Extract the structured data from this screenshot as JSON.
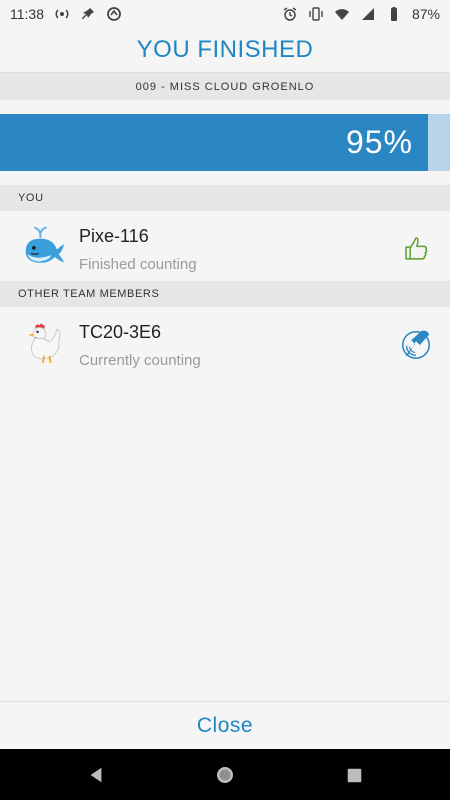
{
  "status_bar": {
    "time": "11:38",
    "battery": "87%",
    "left_icons": [
      "radio-icon",
      "pin-icon",
      "sync-icon"
    ],
    "right_icons": [
      "alarm-icon",
      "vibrate-icon",
      "wifi-icon",
      "signal-icon",
      "battery-icon"
    ]
  },
  "header": {
    "title": "YOU FINISHED"
  },
  "team": {
    "name": "009 - MISS CLOUD GROENLO"
  },
  "progress": {
    "percent_label": "95%",
    "value": 0.95,
    "fill_color": "#2b86c4",
    "track_color": "#b7d4ea"
  },
  "sections": {
    "you_label": "YOU",
    "others_label": "OTHER TEAM MEMBERS"
  },
  "you": {
    "name": "Pixe-116",
    "status": "Finished counting",
    "avatar_icon": "whale-icon",
    "action_icon": "thumbs-up-icon"
  },
  "others": [
    {
      "name": "TC20-3E6",
      "status": "Currently counting",
      "avatar_icon": "rooster-icon",
      "action_icon": "counting-icon"
    }
  ],
  "footer": {
    "close_label": "Close"
  },
  "colors": {
    "accent": "#1f86c4",
    "thumb_green": "#5aa02c"
  },
  "nav": {
    "back_icon": "back-icon",
    "home_icon": "home-icon",
    "recents_icon": "recents-icon"
  }
}
